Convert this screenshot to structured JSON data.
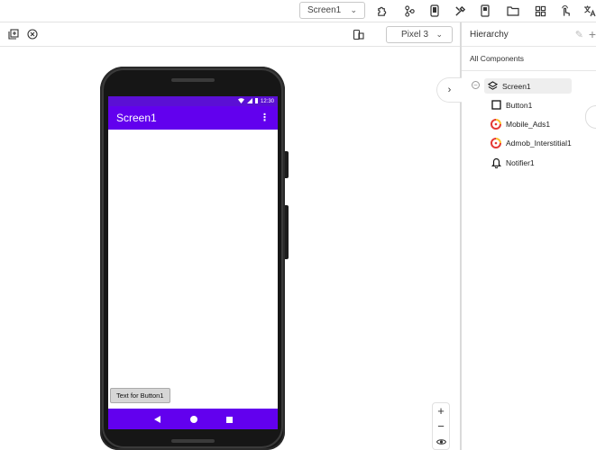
{
  "toolbar": {
    "screen_selector": "Screen1",
    "icons": [
      "puzzle-icon",
      "blocks-icon",
      "phone-icon",
      "build-icon",
      "project-icon",
      "folder-icon",
      "grid-icon",
      "touch-icon",
      "translate-icon"
    ]
  },
  "viewer": {
    "device_selector": "Pixel 3",
    "status_time": "12:30",
    "app_title": "Screen1",
    "button_text": "Text for Button1",
    "zoom_in": "+",
    "zoom_out": "−"
  },
  "hierarchy": {
    "title": "Hierarchy",
    "all_components": "All Components",
    "items": [
      {
        "label": "Screen1",
        "icon": "layers-icon"
      },
      {
        "label": "Button1",
        "icon": "button-icon"
      },
      {
        "label": "Mobile_Ads1",
        "icon": "ads-icon"
      },
      {
        "label": "Admob_Interstitial1",
        "icon": "ads-icon"
      },
      {
        "label": "Notifier1",
        "icon": "bell-icon"
      }
    ]
  },
  "colors": {
    "app_bar": "#6200ee",
    "status_bar": "#5b0fd4",
    "ads_red": "#e53935",
    "ads_yellow": "#fbc02d"
  }
}
